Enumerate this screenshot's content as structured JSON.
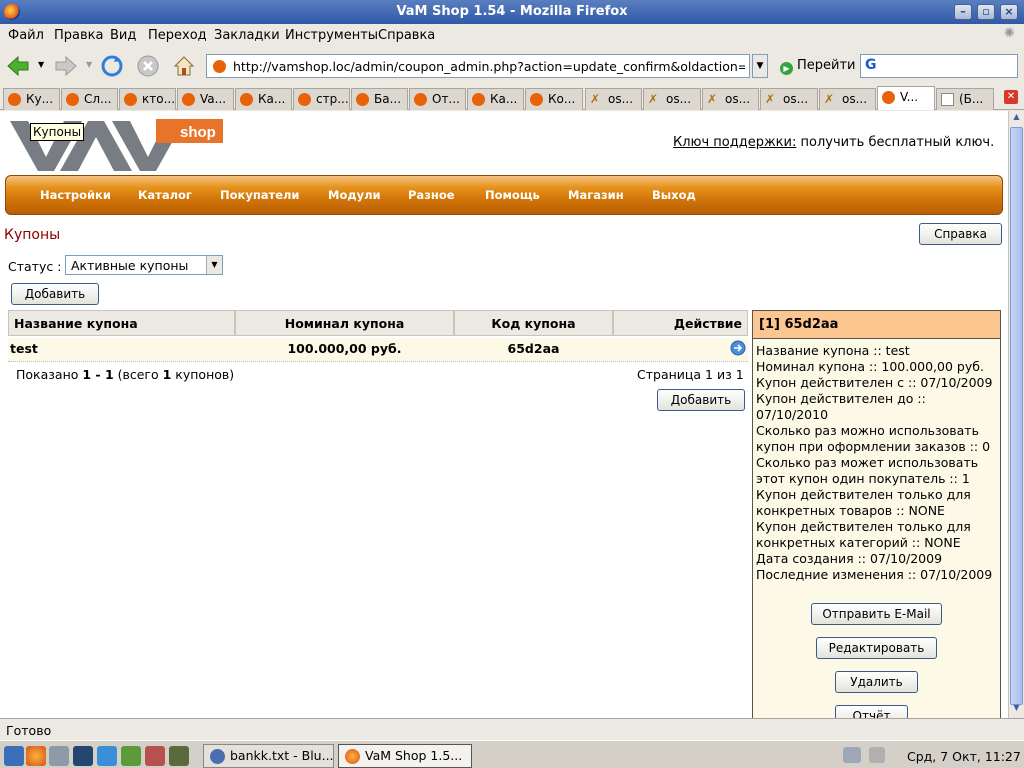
{
  "window": {
    "title": "VaM Shop 1.54 - Mozilla Firefox"
  },
  "menu": [
    "Файл",
    "Правка",
    "Вид",
    "Переход",
    "Закладки",
    "Инструменты",
    "Справка"
  ],
  "navbar": {
    "url": "http://vamshop.loc/admin/coupon_admin.php?action=update_confirm&oldaction=new&ci",
    "go_label": "Перейти",
    "search_glyph": "G"
  },
  "tabs": [
    {
      "label": "Ку...",
      "icon": "vamshop-icon"
    },
    {
      "label": "Сл...",
      "icon": "vamshop-icon"
    },
    {
      "label": "кто...",
      "icon": "vamshop-icon"
    },
    {
      "label": "Va...",
      "icon": "vamshop-icon"
    },
    {
      "label": "Ка...",
      "icon": "vamshop-icon"
    },
    {
      "label": "стр...",
      "icon": "vamshop-icon"
    },
    {
      "label": "Ба...",
      "icon": "vamshop-icon"
    },
    {
      "label": "От...",
      "icon": "vamshop-icon"
    },
    {
      "label": "Ка...",
      "icon": "vamshop-icon"
    },
    {
      "label": "Ко...",
      "icon": "vamshop-icon"
    },
    {
      "label": "os...",
      "icon": "oscommerce-icon"
    },
    {
      "label": "os...",
      "icon": "oscommerce-icon"
    },
    {
      "label": "os...",
      "icon": "oscommerce-icon"
    },
    {
      "label": "os...",
      "icon": "oscommerce-icon"
    },
    {
      "label": "os...",
      "icon": "oscommerce-icon"
    },
    {
      "label": "V...",
      "icon": "vamshop-icon",
      "active": true
    },
    {
      "label": "(Б...",
      "icon": "document-icon"
    }
  ],
  "page": {
    "logo_text": "shop",
    "tooltip": "Купоны",
    "support_link": "Ключ поддержки:",
    "support_text": " получить бесплатный ключ.",
    "nav": [
      "Настройки",
      "Каталог",
      "Покупатели",
      "Модули",
      "Разное",
      "Помощь",
      "Магазин",
      "Выход"
    ],
    "title": "Купоны",
    "help_button": "Справка",
    "status_label": "Статус :",
    "status_value": "Активные купоны",
    "add_button": "Добавить",
    "table": {
      "headers": [
        "Название купона",
        "Номинал купона",
        "Код купона",
        "Действие"
      ],
      "rows": [
        {
          "name": "test",
          "amount": "100.000,00 руб.",
          "code": "65d2aa"
        }
      ]
    },
    "pager_info_pre": "Показано ",
    "pager_info_range": "1 - 1",
    "pager_info_mid": " (всего ",
    "pager_info_total": "1",
    "pager_info_post": " купонов)",
    "pager_pages": "Страница 1 из 1",
    "add_button_bottom": "Добавить"
  },
  "panel": {
    "header": "[1] 65d2aa",
    "lines": [
      "Название купона :: test",
      "Номинал купона :: 100.000,00 руб.",
      "Купон действителен с :: 07/10/2009",
      "Купон действителен до :: 07/10/2010",
      "Сколько раз можно использовать купон при оформлении заказов :: 0",
      "Сколько раз может использовать этот купон один покупатель :: 1",
      "Купон действителен только для конкретных товаров :: NONE",
      "Купон действителен только для конкретных категорий :: NONE",
      "Дата создания :: 07/10/2009",
      "Последние изменения :: 07/10/2009"
    ],
    "buttons": [
      "Отправить E-Mail",
      "Редактировать",
      "Удалить",
      "Отчёт"
    ]
  },
  "statusbar": {
    "text": "Готово"
  },
  "taskbar": {
    "tasks": [
      {
        "label": "bankk.txt - Blu..."
      },
      {
        "label": "VaM Shop 1.5..."
      }
    ],
    "clock": "Срд, 7 Окт, 11:27"
  }
}
